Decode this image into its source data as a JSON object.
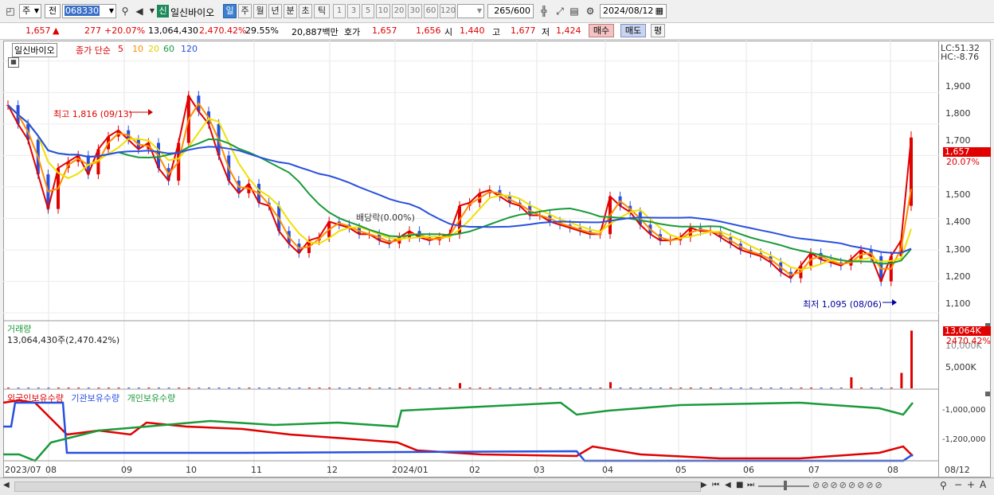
{
  "toolbar": {
    "market": "주",
    "prev": "전",
    "code": "068330",
    "badge": "신",
    "name": "일신바이오",
    "periods": [
      "일",
      "주",
      "월",
      "년",
      "분",
      "초",
      "틱"
    ],
    "active_period": "일",
    "intervals": [
      "1",
      "3",
      "5",
      "10",
      "20",
      "30",
      "60",
      "120"
    ],
    "count": "265",
    "count_total": "/600",
    "date": "2024/08/12"
  },
  "quote": {
    "price": "1,657",
    "change_arrow": "▲",
    "change": "277",
    "change_pct": "+20.07%",
    "volume": "13,064,430",
    "vol_ratio": "2,470.42%",
    "turnover": "29.55%",
    "amount": "20,887백만",
    "bid_label": "호가",
    "bid1": "1,657",
    "bid2": "1,656",
    "open_label": "시",
    "open": "1,440",
    "high_label": "고",
    "high": "1,677",
    "low_label": "저",
    "low": "1,424",
    "buy_btn": "매수",
    "sell_btn": "매도",
    "eval_btn": "평"
  },
  "price_panel": {
    "name_tag": "일신바이오",
    "legend_label": "종가 단순",
    "ma_periods": [
      "5",
      "10",
      "20",
      "60",
      "120"
    ],
    "ma_colors": [
      "#e00000",
      "#ff8c00",
      "#f0e000",
      "#1a9a3a",
      "#2850e0"
    ],
    "annotation_high": "최고 1,816 (09/13)",
    "annotation_low": "최저 1,095 (08/06)",
    "annotation_event": "배당락(0.00%)",
    "lc": "LC:51.32",
    "hc": "HC:-8.76",
    "last_price_tag": "1,657",
    "last_pct_tag": "20.07%",
    "y_ticks": [
      "1,900",
      "1,800",
      "1,700",
      "1,600",
      "1,500",
      "1,400",
      "1,300",
      "1,200",
      "1,100"
    ]
  },
  "volume_panel": {
    "title": "거래량",
    "value": "13,064,430주(2,470.42%)",
    "tag": "13,064K",
    "tag_pct": "2470.42%",
    "y_tick": "5,000K",
    "y_tick_partial": "10,000K"
  },
  "holding_panel": {
    "legends": [
      "외국인보유수량",
      "기관보유수량",
      "개인보유수량"
    ],
    "legend_colors": [
      "#e00000",
      "#2850e0",
      "#1a9a3a"
    ],
    "y_ticks": [
      "-1,000,000",
      "-1,200,000"
    ]
  },
  "x_axis": [
    "2023/07",
    "08",
    "09",
    "10",
    "11",
    "12",
    "2024/01",
    "02",
    "03",
    "04",
    "05",
    "06",
    "07",
    "08",
    "08/12"
  ],
  "chart_data": {
    "type": "candlestick",
    "title": "일신바이오",
    "ylim": [
      1080,
      1960
    ],
    "x_range": [
      "2023/07",
      "2024/08/12"
    ],
    "last": {
      "open": 1440,
      "high": 1677,
      "low": 1424,
      "close": 1657,
      "volume": 13064430
    },
    "period_high": {
      "value": 1816,
      "date": "09/13"
    },
    "period_low": {
      "value": 1095,
      "date": "08/06"
    },
    "closing_series": [
      1760,
      1700,
      1650,
      1540,
      1430,
      1560,
      1580,
      1600,
      1540,
      1620,
      1660,
      1680,
      1650,
      1620,
      1640,
      1560,
      1520,
      1640,
      1790,
      1740,
      1700,
      1600,
      1520,
      1480,
      1510,
      1450,
      1440,
      1360,
      1320,
      1290,
      1330,
      1340,
      1390,
      1380,
      1370,
      1350,
      1350,
      1330,
      1320,
      1340,
      1360,
      1340,
      1330,
      1340,
      1350,
      1440,
      1450,
      1480,
      1490,
      1470,
      1450,
      1440,
      1410,
      1410,
      1390,
      1380,
      1370,
      1360,
      1350,
      1350,
      1470,
      1440,
      1420,
      1380,
      1350,
      1330,
      1330,
      1340,
      1370,
      1360,
      1360,
      1340,
      1320,
      1300,
      1290,
      1280,
      1260,
      1230,
      1210,
      1250,
      1290,
      1270,
      1260,
      1250,
      1270,
      1300,
      1280,
      1200,
      1280,
      1330,
      1657
    ],
    "volume_k": [
      50,
      40,
      60,
      30,
      40,
      80,
      30,
      30,
      40,
      30,
      40,
      60,
      40,
      30,
      40,
      30,
      40,
      30,
      60,
      90,
      40,
      30,
      30,
      30,
      40,
      30,
      30,
      30,
      30,
      30,
      40,
      30,
      30,
      30,
      30,
      30,
      30,
      30,
      30,
      30,
      30,
      30,
      30,
      40,
      30,
      1200,
      60,
      40,
      40,
      40,
      30,
      30,
      30,
      30,
      30,
      30,
      30,
      30,
      40,
      30,
      1400,
      60,
      40,
      30,
      30,
      30,
      30,
      30,
      30,
      30,
      30,
      30,
      30,
      30,
      30,
      30,
      30,
      30,
      30,
      30,
      30,
      30,
      30,
      30,
      2500,
      90,
      60,
      40,
      50,
      3500,
      13064
    ]
  }
}
